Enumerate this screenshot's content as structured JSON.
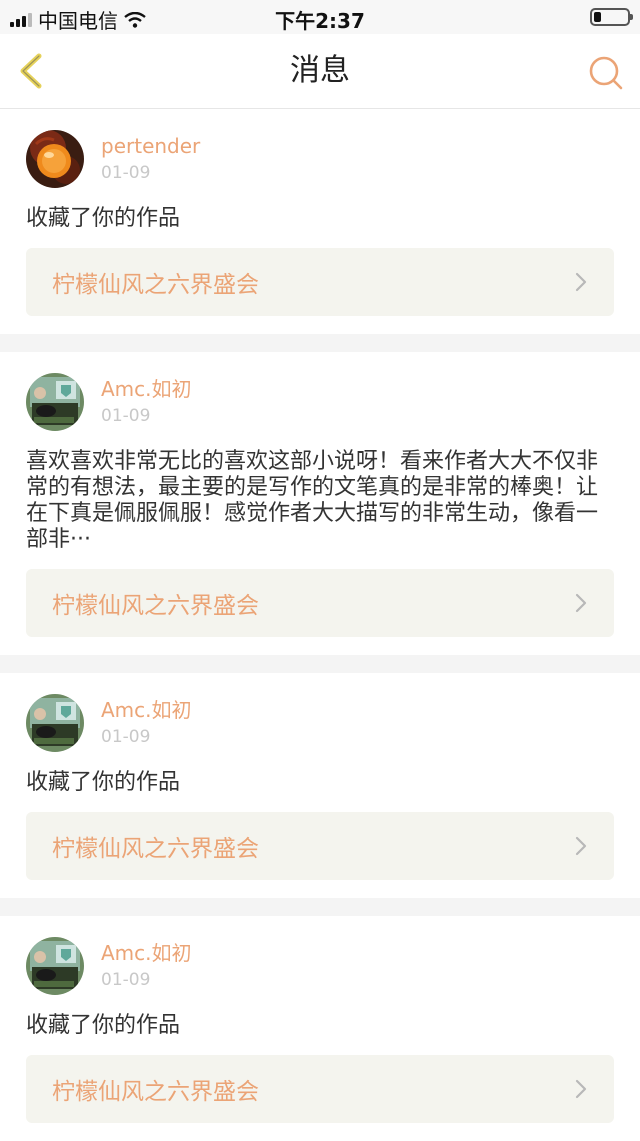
{
  "status_bar": {
    "carrier": "中国电信",
    "time": "下午2:37",
    "battery_level": 0.2
  },
  "nav": {
    "title": "消息",
    "back_icon": "chevron-left-icon",
    "search_icon": "search-icon",
    "accent_color": "#eba476"
  },
  "messages": [
    {
      "username": "pertender",
      "date": "01-09",
      "avatar": "orange-avatar",
      "content": "收藏了你的作品",
      "work_title": "柠檬仙风之六界盛会"
    },
    {
      "username": "Amc.如初",
      "date": "01-09",
      "avatar": "photo-avatar",
      "content": "喜欢喜欢非常无比的喜欢这部小说呀！看来作者大大不仅非常的有想法，最主要的是写作的文笔真的是非常的棒奥！让在下真是佩服佩服！感觉作者大大描写的非常生动，像看一部非···",
      "work_title": "柠檬仙风之六界盛会"
    },
    {
      "username": "Amc.如初",
      "date": "01-09",
      "avatar": "photo-avatar",
      "content": "收藏了你的作品",
      "work_title": "柠檬仙风之六界盛会"
    },
    {
      "username": "Amc.如初",
      "date": "01-09",
      "avatar": "photo-avatar",
      "content": "收藏了你的作品",
      "work_title": "柠檬仙风之六界盛会"
    }
  ]
}
